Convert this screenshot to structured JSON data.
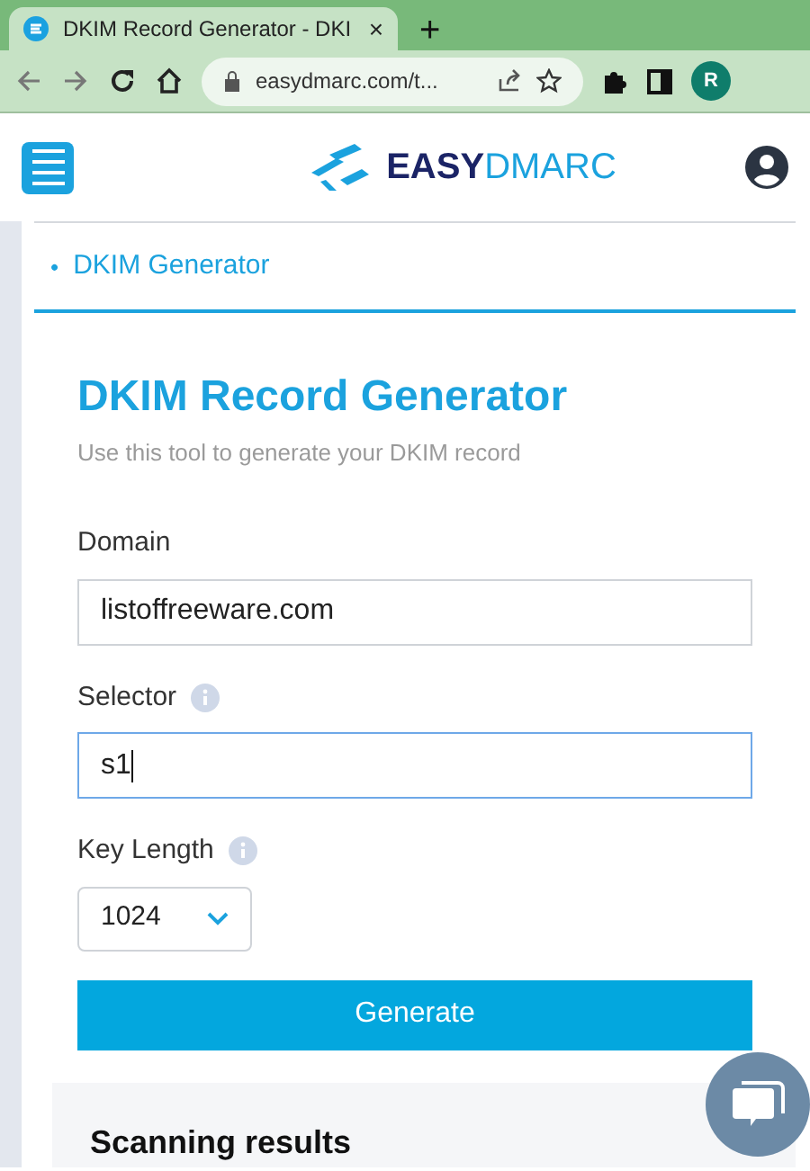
{
  "browser": {
    "tab": {
      "title": "DKIM Record Generator - DKI",
      "close": "×"
    },
    "new_tab": "+",
    "address": "easydmarc.com/t...",
    "profile": "R"
  },
  "header": {
    "logo_part_1": "EASY",
    "logo_part_2": "DMARC"
  },
  "breadcrumb": {
    "bullet": "•",
    "label": "DKIM Generator"
  },
  "form": {
    "title": "DKIM Record Generator",
    "subtitle": "Use this tool to generate your DKIM record",
    "fields": [
      {
        "kind": "text",
        "label": "Domain",
        "value": "listoffreeware.com",
        "info": false,
        "focused": false
      },
      {
        "kind": "text",
        "label": "Selector",
        "value": "s1",
        "info": true,
        "focused": true
      },
      {
        "kind": "select",
        "label": "Key Length",
        "value": "1024",
        "info": true,
        "focused": false
      }
    ],
    "button": "Generate"
  },
  "results": {
    "title": "Scanning results"
  }
}
